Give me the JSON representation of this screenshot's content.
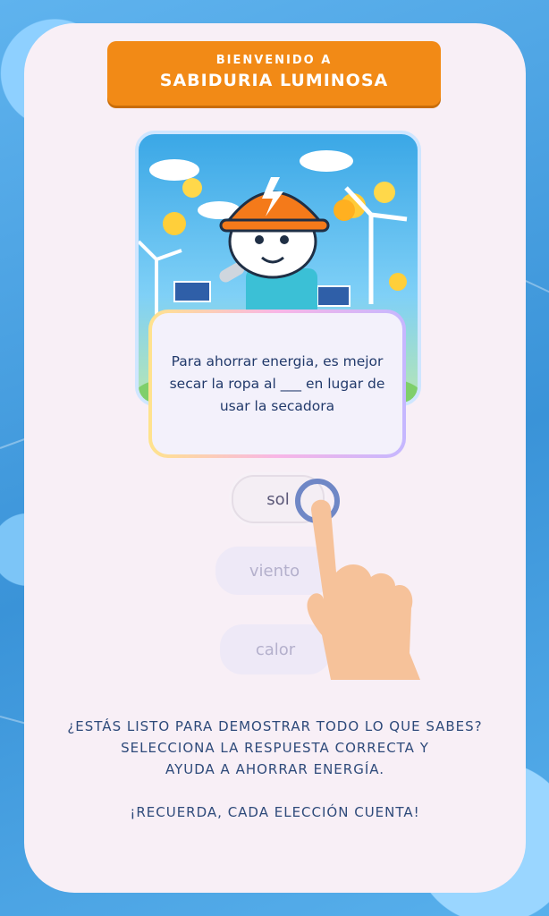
{
  "banner": {
    "line1": "BIENVENIDO A",
    "line2": "SABIDURIA LUMINOSA"
  },
  "question": {
    "text": "Para ahorrar energia, es mejor secar la ropa al ___ en lugar de usar la secadora"
  },
  "options": [
    {
      "label": "sol",
      "selected": true
    },
    {
      "label": "viento",
      "selected": false
    },
    {
      "label": "calor",
      "selected": false
    }
  ],
  "instructions": {
    "line1": "¿ESTÁS LISTO PARA DEMOSTRAR TODO LO QUE SABES?",
    "line2": "SELECCIONA LA RESPUESTA CORRECTA Y",
    "line3": "AYUDA A AHORRAR ENERGÍA.",
    "line4": "¡RECUERDA, CADA ELECCIÓN CUENTA!"
  },
  "colors": {
    "banner": "#f28a16",
    "card": "#f8eff6",
    "background": "#3f9fe0",
    "text": "#2e4a7a"
  },
  "icons": [
    "robot-mascot-illustration",
    "tap-hand-icon"
  ]
}
